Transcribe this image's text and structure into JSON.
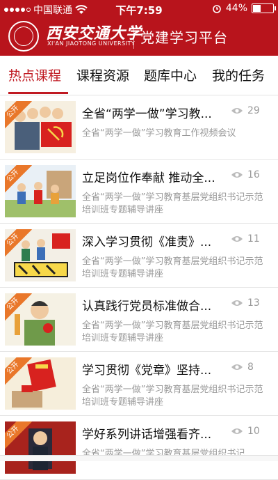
{
  "status": {
    "carrier": "中国联通",
    "time": "下午7:59",
    "battery": "44%",
    "battery_level": 0.44
  },
  "header": {
    "logo_cn": "西安交通大学",
    "logo_en": "XI'AN JIAOTONG UNIVERSITY",
    "app_title": "党建学习平台",
    "accent": "#b8141c"
  },
  "tabs": [
    {
      "label": "热点课程",
      "active": true
    },
    {
      "label": "课程资源",
      "active": false
    },
    {
      "label": "题库中心",
      "active": false
    },
    {
      "label": "我的任务",
      "active": false
    }
  ],
  "courses": [
    {
      "title": "全省“两学一做”学习教...",
      "views": "29",
      "desc": "全省“两学一做”学习教育工作视频会议",
      "badge": "公开",
      "icon": "party-members-illustration"
    },
    {
      "title": "立足岗位作奉献 推动全...",
      "views": "16",
      "desc": "全省“两学一做”学习教育基层党组织书记示范培训班专题辅导讲座",
      "badge": "公开",
      "icon": "workers-illustration"
    },
    {
      "title": "深入学习贯彻《准责》...",
      "views": "11",
      "desc": "全省“两学一做”学习教育基层党组织书记示范培训班专题辅导讲座",
      "badge": "公开",
      "icon": "rules-illustration"
    },
    {
      "title": "认真践行党员标准做合...",
      "views": "13",
      "desc": "全省“两学一做”学习教育基层党组织书记示范培训班专题辅导讲座",
      "badge": "公开",
      "icon": "party-member-illustration"
    },
    {
      "title": "学习贯彻《党章》坚持...",
      "views": "8",
      "desc": "全省“两学一做”学习教育基层党组织书记示范培训班专题辅导讲座",
      "badge": "公开",
      "icon": "party-constitution-illustration"
    },
    {
      "title": "学好系列讲话增强看齐...",
      "views": "10",
      "desc": "全省“两学一做”学习教育基层党组织书记",
      "badge": "公开",
      "icon": "speech-photo"
    }
  ]
}
